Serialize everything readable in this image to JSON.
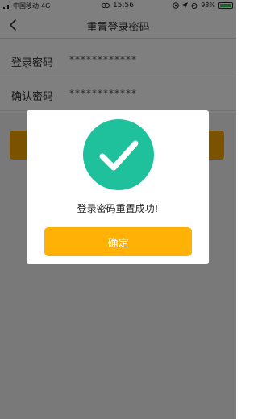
{
  "status_bar": {
    "carrier": "中国移动",
    "network": "4G",
    "time": "15:56",
    "battery": "98%"
  },
  "nav": {
    "title": "重置登录密码",
    "back_icon": "chevron-left-icon"
  },
  "form": {
    "password_label": "登录密码",
    "password_value": "************",
    "confirm_label": "确认密码",
    "confirm_value": "************"
  },
  "dialog": {
    "icon": "check-circle-icon",
    "message": "登录密码重置成功!",
    "confirm_label": "确定"
  },
  "colors": {
    "accent": "#ffb106",
    "success": "#1fc19c",
    "battery": "#31c55b"
  }
}
